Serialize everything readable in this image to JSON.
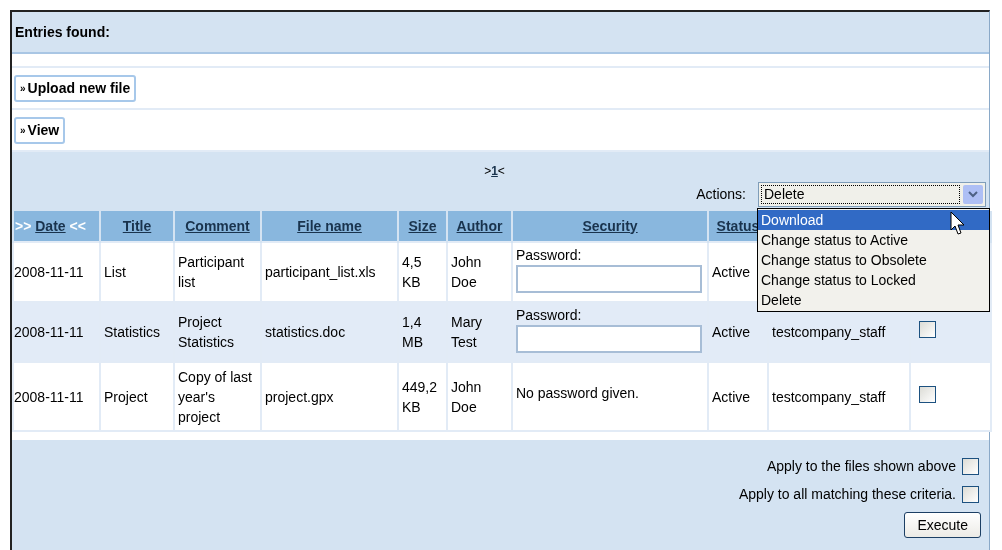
{
  "header": {
    "title": "Entries found:"
  },
  "buttons": [
    {
      "label": "Upload new file",
      "marker": "»"
    },
    {
      "label": "View",
      "marker": "»"
    }
  ],
  "pager": {
    "before": ">",
    "page": "1",
    "after": "<"
  },
  "actions": {
    "label": "Actions:",
    "value": "Delete",
    "options": [
      {
        "label": "Download",
        "highlighted": true
      },
      {
        "label": "Change status to Active",
        "highlighted": false
      },
      {
        "label": "Change status to Obsolete",
        "highlighted": false
      },
      {
        "label": "Change status to Locked",
        "highlighted": false
      },
      {
        "label": "Delete",
        "highlighted": false
      }
    ]
  },
  "table": {
    "columns": [
      {
        "label": "Date",
        "sorted": true,
        "sort_before": ">>",
        "sort_after": "<<"
      },
      {
        "label": "Title",
        "sorted": false
      },
      {
        "label": "Comment",
        "sorted": false
      },
      {
        "label": "File name",
        "sorted": false
      },
      {
        "label": "Size",
        "sorted": false
      },
      {
        "label": "Author",
        "sorted": false
      },
      {
        "label": "Security",
        "sorted": false
      },
      {
        "label": "Status",
        "sorted": false
      }
    ],
    "rows": [
      {
        "date": "2008-11-11",
        "title": "List",
        "comment": "Participant list",
        "file_name": "participant_list.xls",
        "size": "4,5 KB",
        "author": "John Doe",
        "security": {
          "kind": "password",
          "label": "Password:"
        },
        "status": "Active"
      },
      {
        "date": "2008-11-11",
        "title": "Statistics",
        "comment": "Project Statistics",
        "file_name": "statistics.doc",
        "size": "1,4 MB",
        "author": "Mary Test",
        "security": {
          "kind": "password",
          "label": "Password:"
        },
        "status": "Active",
        "group": "testcompany_staff",
        "checked": false
      },
      {
        "date": "2008-11-11",
        "title": "Project",
        "comment": "Copy of last year's project",
        "file_name": "project.gpx",
        "size": "449,2 KB",
        "author": "John Doe",
        "security": {
          "kind": "text",
          "text": "No password given."
        },
        "status": "Active",
        "group": "testcompany_staff",
        "checked": false
      }
    ]
  },
  "apply": [
    {
      "label": "Apply to the files shown above",
      "checked": false
    },
    {
      "label": "Apply to all matching these criteria.",
      "checked": false
    }
  ],
  "execute": {
    "label": "Execute"
  }
}
